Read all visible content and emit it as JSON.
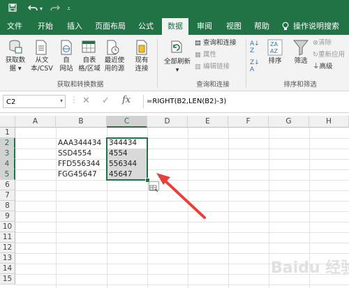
{
  "app": {
    "accent": "#217346",
    "title_icons": [
      "save-icon",
      "undo-icon",
      "redo-icon",
      "customize-qat-icon"
    ]
  },
  "menu": {
    "tabs": [
      "文件",
      "开始",
      "插入",
      "页面布局",
      "公式",
      "数据",
      "审阅",
      "视图",
      "帮助"
    ],
    "active": "数据",
    "tell_me": "操作说明搜索"
  },
  "ribbon": {
    "get_data": {
      "line1": "获取数",
      "line2": "据"
    },
    "from_text": {
      "line1": "从文",
      "line2": "本/CSV"
    },
    "from_web": {
      "line1": "自",
      "line2": "网站"
    },
    "from_table": {
      "line1": "自表",
      "line2": "格/区域"
    },
    "recent_sources": {
      "line1": "最近使",
      "line2": "用的源"
    },
    "existing_conn": {
      "line1": "现有",
      "line2": "连接"
    },
    "group1_label": "获取和转换数据",
    "refresh_all": {
      "line1": "全部刷新",
      "line2": ""
    },
    "queries_connections": "查询和连接",
    "properties": "属性",
    "edit_links": "编辑链接",
    "group2_label": "查询和连接",
    "sort": "排序",
    "filter": "筛选",
    "clear": "清除",
    "reapply": "重新应用",
    "advanced": "高级",
    "group3_label": "排序和筛选"
  },
  "formula_bar": {
    "name_box": "C2",
    "formula": "=RIGHT(B2,LEN(B2)-3)"
  },
  "sheet": {
    "columns": [
      "A",
      "B",
      "C",
      "D",
      "E",
      "F",
      "G",
      "H"
    ],
    "rows": [
      "1",
      "2",
      "3",
      "4",
      "5",
      "6",
      "7",
      "8",
      "9",
      "10",
      "11",
      "12",
      "13",
      "14",
      "15"
    ],
    "b_values": [
      "AAA344434",
      "SSD4554",
      "FFD556344",
      "FGG45647"
    ],
    "c_values": [
      "344434",
      "4554",
      "556344",
      "45647"
    ],
    "selected_column": "C",
    "selected_rows": [
      "2",
      "3",
      "4",
      "5"
    ]
  },
  "overlay": {
    "annotation_color": "#e8413c",
    "watermark": "Baidu 经验"
  }
}
